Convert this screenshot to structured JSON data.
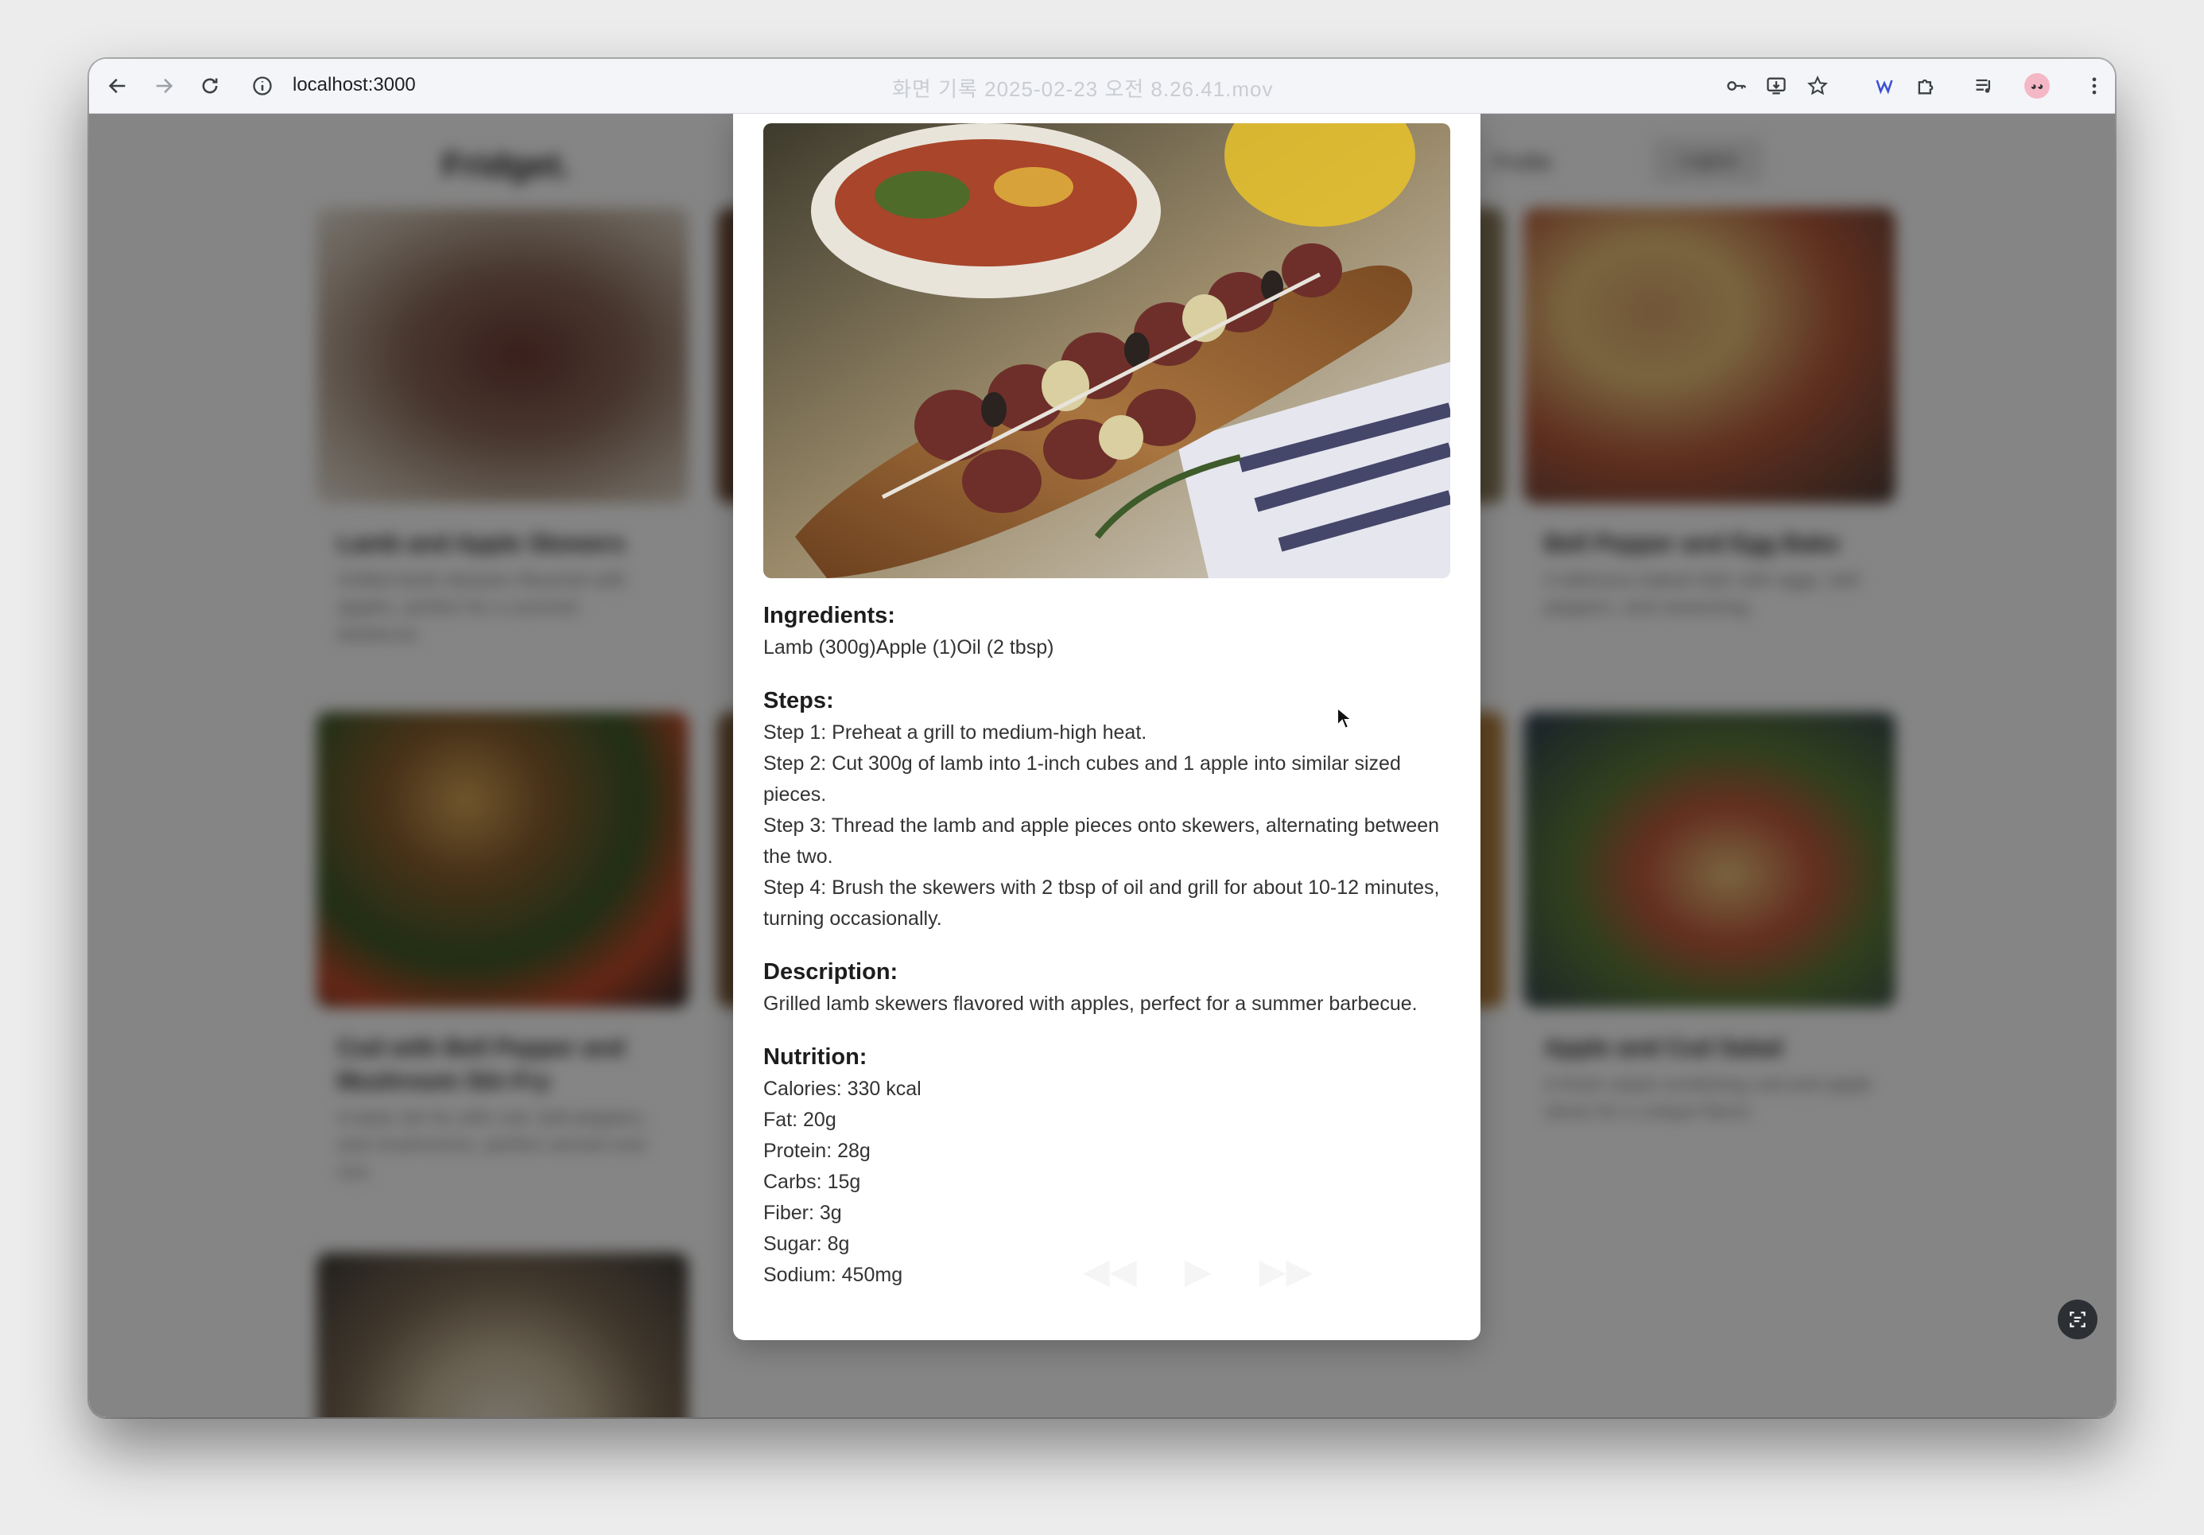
{
  "browser": {
    "url": "localhost:3000",
    "ghost_title": "화면 기록 2025-02-23 오전 8.26.41.mov"
  },
  "app": {
    "logo": "Fridget.",
    "nav_profile": "Profile",
    "logout_label": "Logout"
  },
  "background_cards": [
    {
      "title": "Lamb and Apple Skewers",
      "desc": "Grilled lamb skewers flavored with apples, perfect for a summer barbecue."
    },
    {
      "title": "Bell Pepper and Egg Bake",
      "desc": "A delicious baked dish with eggs, bell peppers, and seasoning."
    },
    {
      "title": "Cod with Bell Pepper and Mushroom Stir-Fry",
      "desc": "A tasty stir-fry with cod, bell peppers, and mushrooms, perfect served over rice."
    },
    {
      "title": "Apple and Cod Salad",
      "desc": "A fresh salad combining cod and apple slices for a unique flavor."
    }
  ],
  "modal": {
    "image_alt": "Grilled lamb and apple skewers on a wooden board",
    "ingredients_title": "Ingredients:",
    "ingredients": "Lamb (300g)Apple (1)Oil (2 tbsp)",
    "steps_title": "Steps:",
    "steps": [
      "Step 1: Preheat a grill to medium-high heat.",
      "Step 2: Cut 300g of lamb into 1-inch cubes and 1 apple into similar sized pieces.",
      "Step 3: Thread the lamb and apple pieces onto skewers, alternating between the two.",
      "Step 4: Brush the skewers with 2 tbsp of oil and grill for about 10-12 minutes, turning occasionally."
    ],
    "description_title": "Description:",
    "description": "Grilled lamb skewers flavored with apples, perfect for a summer barbecue.",
    "nutrition_title": "Nutrition:",
    "nutrition": [
      "Calories: 330 kcal",
      "Fat: 20g",
      "Protein: 28g",
      "Carbs: 15g",
      "Fiber: 3g",
      "Sugar: 8g",
      "Sodium: 450mg"
    ]
  },
  "icons": [
    "back-arrow-icon",
    "forward-arrow-icon",
    "reload-icon",
    "site-info-icon",
    "password-key-icon",
    "install-icon",
    "bookmark-star-icon",
    "extension-icon",
    "puzzle-icon",
    "media-queue-icon",
    "profile-avatar-icon",
    "more-menu-icon",
    "screen-capture-icon"
  ]
}
